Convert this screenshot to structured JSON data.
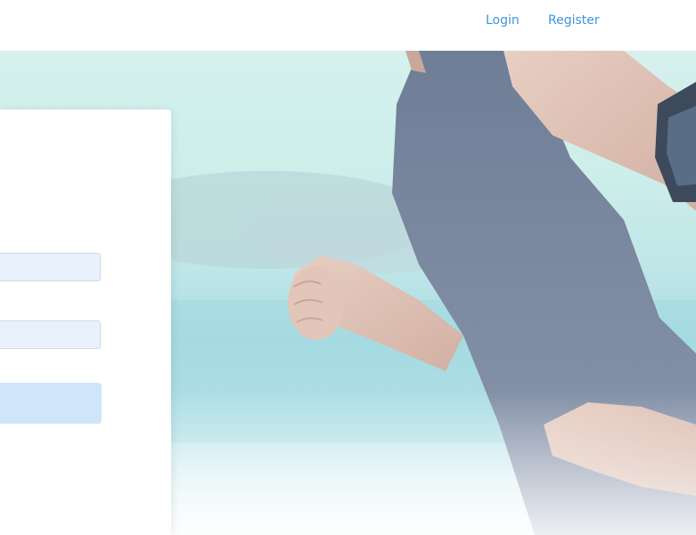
{
  "nav": {
    "login_label": "Login",
    "register_label": "Register"
  },
  "form": {
    "username": {
      "value": "",
      "placeholder": ""
    },
    "password": {
      "value": "",
      "placeholder": ""
    },
    "submit_label": ""
  },
  "colors": {
    "accent": "#3b97d4",
    "input_bg": "#e9f1fd",
    "button_bg": "#cfe5f9"
  }
}
